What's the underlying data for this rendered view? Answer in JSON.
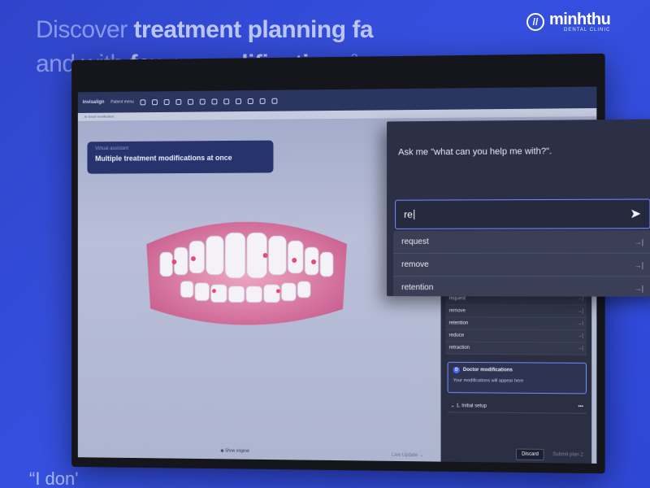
{
  "headline": {
    "line1_plain": "Discover ",
    "line1_bold": "treatment planning fa",
    "line2_plain": "and with ",
    "line2_bold": "fewer modifications",
    "line2_sup": "2",
    "line2_end": "."
  },
  "quote_mark": "“I don'",
  "logo": {
    "brand": "minhthu",
    "sub": "DENTAL CLINIC"
  },
  "app": {
    "brand": "invisalign",
    "patient_menu": "Patient menu",
    "breadcrumb": "AI Smart modification",
    "banner": {
      "tag": "Virtual assistant",
      "title": "Multiple treatment modifications at once"
    },
    "show_original": "Show original",
    "live_update": "Live Update"
  },
  "chat": {
    "prompt": "Ask me \"what can you help me with?\".",
    "input_value": "re",
    "suggestions": [
      "request",
      "remove",
      "retention"
    ]
  },
  "side": {
    "suggestions": [
      "request",
      "remove",
      "retention",
      "reduce",
      "retraction"
    ],
    "doctor_mod_title": "Doctor modifications",
    "doctor_mod_body": "Your modifications will appear here",
    "setup_label": "1. Initial setup",
    "discard": "Discard",
    "submit": "Submit plan 2"
  },
  "colors": {
    "accent": "#6f8dff",
    "background": "#3550e0"
  }
}
